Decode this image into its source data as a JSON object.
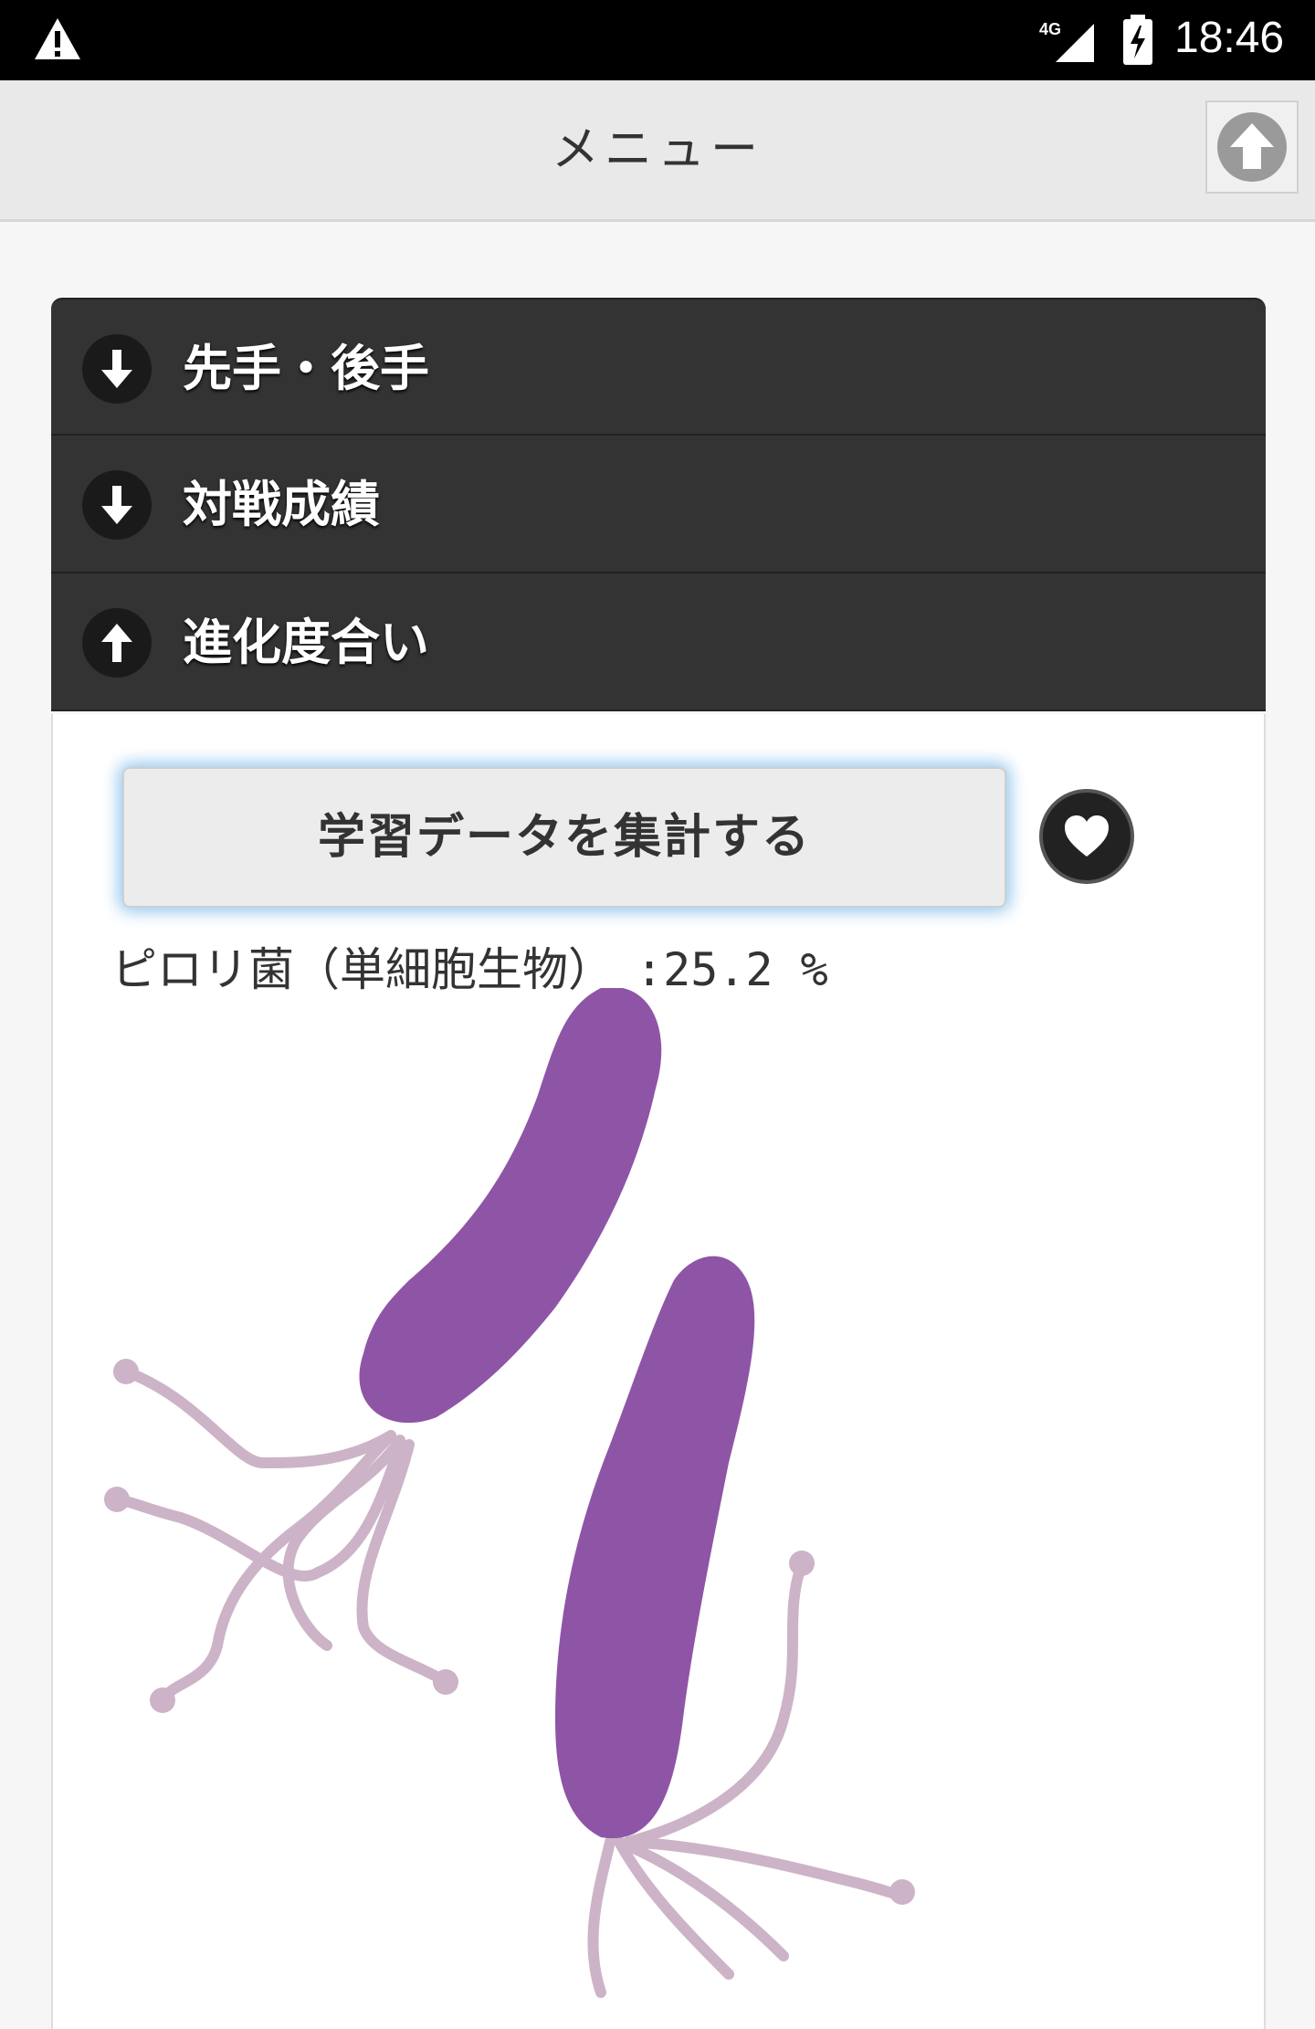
{
  "status_bar": {
    "time": "18:46",
    "network": "4G"
  },
  "header": {
    "title": "メニュー"
  },
  "accordion": {
    "items": [
      {
        "label": "先手・後手",
        "state": "collapsed",
        "icon": "arrow-down-icon"
      },
      {
        "label": "対戦成績",
        "state": "collapsed",
        "icon": "arrow-down-icon"
      },
      {
        "label": "進化度合い",
        "state": "expanded",
        "icon": "arrow-up-icon"
      }
    ]
  },
  "evolution": {
    "aggregate_button": "学習データを集計する",
    "result_label": "ピロリ菌（単細胞生物）",
    "result_value": ":25.2 %",
    "image": "helicobacter-pylori-illustration"
  },
  "colors": {
    "accordion_bg": "#333333",
    "button_glow": "#8ec5ee",
    "bacteria_body": "#8e55a6",
    "flagella": "#cdb3c7"
  }
}
